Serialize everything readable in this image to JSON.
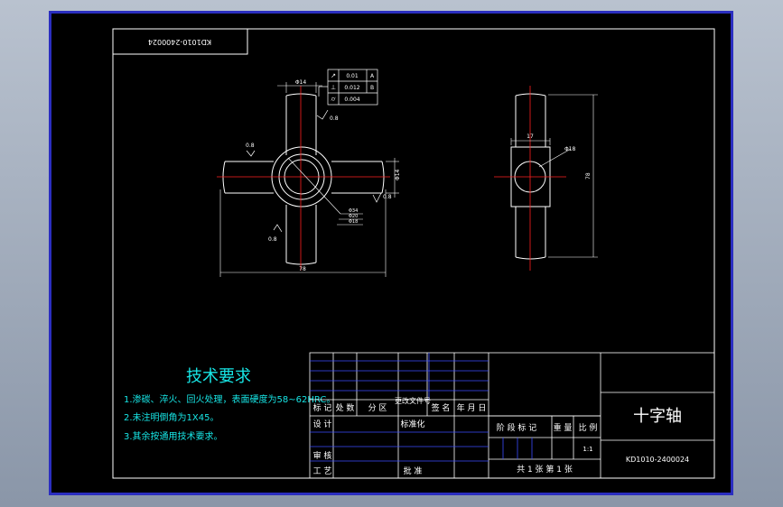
{
  "drawing_code": "KD1010-2400024",
  "drawing_code_mirrored": "KD1010-2400024",
  "part_name": "十字轴",
  "tech_requirements": {
    "title": "技术要求",
    "items": [
      "1.渗碳、淬火、回火处理，表面硬度为58~62HRC。",
      "2.未注明倒角为1X45。",
      "3.其余按通用技术要求。"
    ]
  },
  "title_block": {
    "rev_headers": [
      "标 记",
      "处 数",
      "分 区",
      "更改文件号",
      "签 名",
      "年 月 日"
    ],
    "design": "设 计",
    "standardize": "标准化",
    "check": "审 核",
    "process": "工 艺",
    "approve": "批 准",
    "stage_headers": [
      "阶 段 标 记",
      "重 量",
      "比 例"
    ],
    "scale": "1:1",
    "sheets": "共 1 张 第 1 张"
  },
  "tolerance_frame": {
    "rows": [
      {
        "symbol": "↗",
        "value": "0.01",
        "datum": "A"
      },
      {
        "symbol": "⊥",
        "value": "0.012",
        "datum": "B"
      },
      {
        "symbol": "⌭",
        "value": "0.004",
        "datum": ""
      }
    ]
  },
  "dimensions": {
    "shaft_dia_top": "Φ14",
    "shaft_dia_right": "Φ14",
    "overall_width": "78",
    "overall_height": "78",
    "hole_dia": "Φ18",
    "width_17": "17",
    "roughness_a": "0.8",
    "roughness_b": "0.8",
    "roughness_c": "0.8",
    "roughness_d": "0.8",
    "callout_1": "Φ34",
    "callout_2": "Φ20",
    "callout_3": "Φ18"
  },
  "colors": {
    "line_white": "#ffffff",
    "centerline_red": "#ff2020",
    "cyan_text": "#17e6e6",
    "blue_lines": "#3a4cff",
    "frame_blue": "#2b2ec0"
  }
}
